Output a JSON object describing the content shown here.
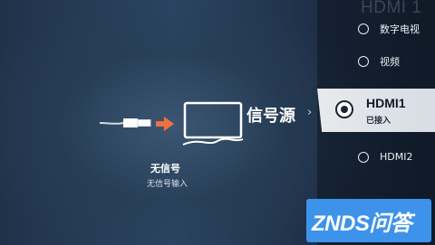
{
  "header": {
    "current_source_faded": "HDMI 1"
  },
  "status": {
    "title": "无信号",
    "subtitle": "无信号输入"
  },
  "source_menu": {
    "title": "信号源",
    "chevron": "›",
    "items": [
      {
        "label": "数字电视",
        "selected": false
      },
      {
        "label": "视频",
        "selected": false
      },
      {
        "label": "HDMI1",
        "sublabel": "已接入",
        "selected": true
      },
      {
        "label": "HDMI2",
        "selected": false
      }
    ]
  },
  "watermark": {
    "text": "ZNDS问答"
  },
  "colors": {
    "accent_arrow": "#f0703e",
    "logo_bg": "#3d93ea",
    "selected_bg": "#eef2f6"
  },
  "icons": [
    "hdmi-cable-icon",
    "arrow-right-icon",
    "tv-icon",
    "radio-button-icon",
    "radio-selected-icon"
  ]
}
